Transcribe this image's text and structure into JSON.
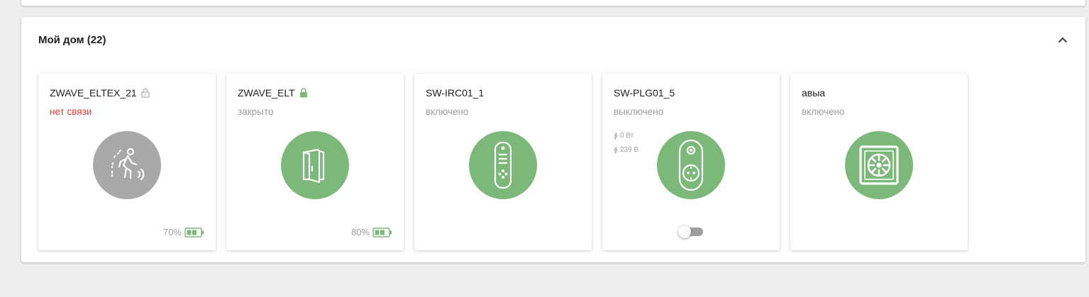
{
  "group": {
    "title": "Мой дом (22)",
    "collapse_icon": "chevron-up-icon"
  },
  "colors": {
    "accent_green": "#7cb87a",
    "offline_gray": "#a8a8a8",
    "error_red": "#e53935"
  },
  "devices": [
    {
      "name": "ZWAVE_ELTEX_21",
      "status": "нет связи",
      "lock_icon": "lock-open-outline-icon",
      "icon": "motion-sensor-icon",
      "battery": "70%"
    },
    {
      "name": "ZWAVE_ELT",
      "status": "закрыто",
      "lock_icon": "lock-closed-icon",
      "icon": "door-sensor-icon",
      "battery": "80%"
    },
    {
      "name": "SW-IRC01_1",
      "status": "включено",
      "icon": "ir-remote-icon"
    },
    {
      "name": "SW-PLG01_5",
      "status": "выключено",
      "icon": "smart-plug-icon",
      "power": "0 Вт",
      "voltage": "239 В",
      "switch_on": false
    },
    {
      "name": "авыа",
      "status": "включено",
      "icon": "ventilation-fan-icon"
    }
  ]
}
